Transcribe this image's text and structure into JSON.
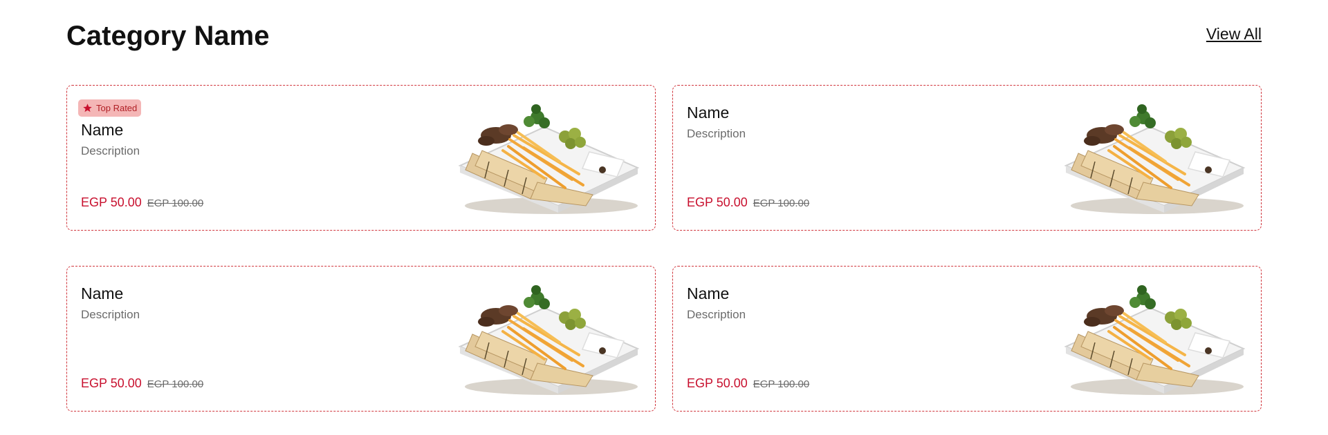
{
  "header": {
    "title": "Category Name",
    "view_all_label": "View All"
  },
  "colors": {
    "accent": "#c8102e",
    "card_border": "#d0333a",
    "badge_bg": "#f4b6b6",
    "muted_text": "#6b6b6b"
  },
  "items": [
    {
      "badge": {
        "label": "Top Rated",
        "icon": "star-icon"
      },
      "name": "Name",
      "description": "Description",
      "price": "EGP 50.00",
      "old_price": "EGP 100.00",
      "image": "shawarma-platter-image"
    },
    {
      "name": "Name",
      "description": "Description",
      "price": "EGP 50.00",
      "old_price": "EGP 100.00",
      "image": "shawarma-platter-image"
    },
    {
      "name": "Name",
      "description": "Description",
      "price": "EGP 50.00",
      "old_price": "EGP 100.00",
      "image": "shawarma-platter-image"
    },
    {
      "name": "Name",
      "description": "Description",
      "price": "EGP 50.00",
      "old_price": "EGP 100.00",
      "image": "shawarma-platter-image"
    }
  ]
}
